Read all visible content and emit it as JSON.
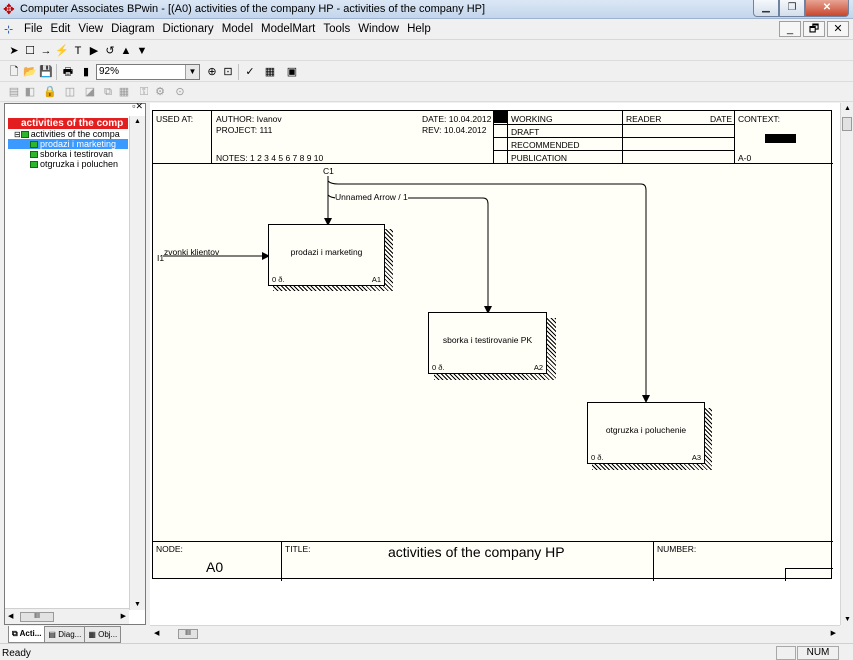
{
  "window": {
    "title": "Computer Associates BPwin - [(A0) activities of the company HP - activities of the company HP]",
    "min_label": "▁",
    "max_label": "❐",
    "close_label": "✕"
  },
  "menu": {
    "items": [
      "File",
      "Edit",
      "View",
      "Diagram",
      "Dictionary",
      "Model",
      "ModelMart",
      "Tools",
      "Window",
      "Help"
    ],
    "mdi_min": "_",
    "mdi_restore": "🗗",
    "mdi_close": "✕"
  },
  "toolbar": {
    "zoom": "92%"
  },
  "explorer": {
    "root": "activities of the comp",
    "items": [
      {
        "label": "activities of the compa",
        "selected": false
      },
      {
        "label": "prodazi i marketing",
        "selected": true
      },
      {
        "label": "sborka i testirovan",
        "selected": false
      },
      {
        "label": "otgruzka i poluchen",
        "selected": false
      }
    ],
    "hscroll_label": "III",
    "tabs": [
      "Acti...",
      "Diag...",
      "Obj..."
    ]
  },
  "header": {
    "used_at": "USED AT:",
    "author": "AUTHOR:  Ivanov",
    "project": "PROJECT:  111",
    "date": "DATE:  10.04.2012",
    "rev": "REV:   10.04.2012",
    "notes": "NOTES:  1  2  3  4  5  6  7  8  9  10",
    "status": [
      "WORKING",
      "DRAFT",
      "RECOMMENDED",
      "PUBLICATION"
    ],
    "reader": "READER",
    "reader_date": "DATE",
    "context": "CONTEXT:",
    "context_node": "A-0"
  },
  "diagram": {
    "control_label": "C1",
    "arrow_label": "Unnamed Arrow / 1",
    "input_label": "I1",
    "input_arrow": "zvonki klientov",
    "boxes": [
      {
        "label": "prodazi i marketing",
        "cost": "0 ð.",
        "num": "A1"
      },
      {
        "label": "sborka i testirovanie PK",
        "cost": "0 ð.",
        "num": "A2"
      },
      {
        "label": "otgruzka i poluchenie",
        "cost": "0 ð.",
        "num": "A3"
      }
    ]
  },
  "footer": {
    "node_label": "NODE:",
    "node": "A0",
    "title_label": "TITLE:",
    "title": "activities of the company HP",
    "number_label": "NUMBER:"
  },
  "hscroll_label": "III",
  "status": {
    "text": "Ready",
    "num": "NUM"
  }
}
